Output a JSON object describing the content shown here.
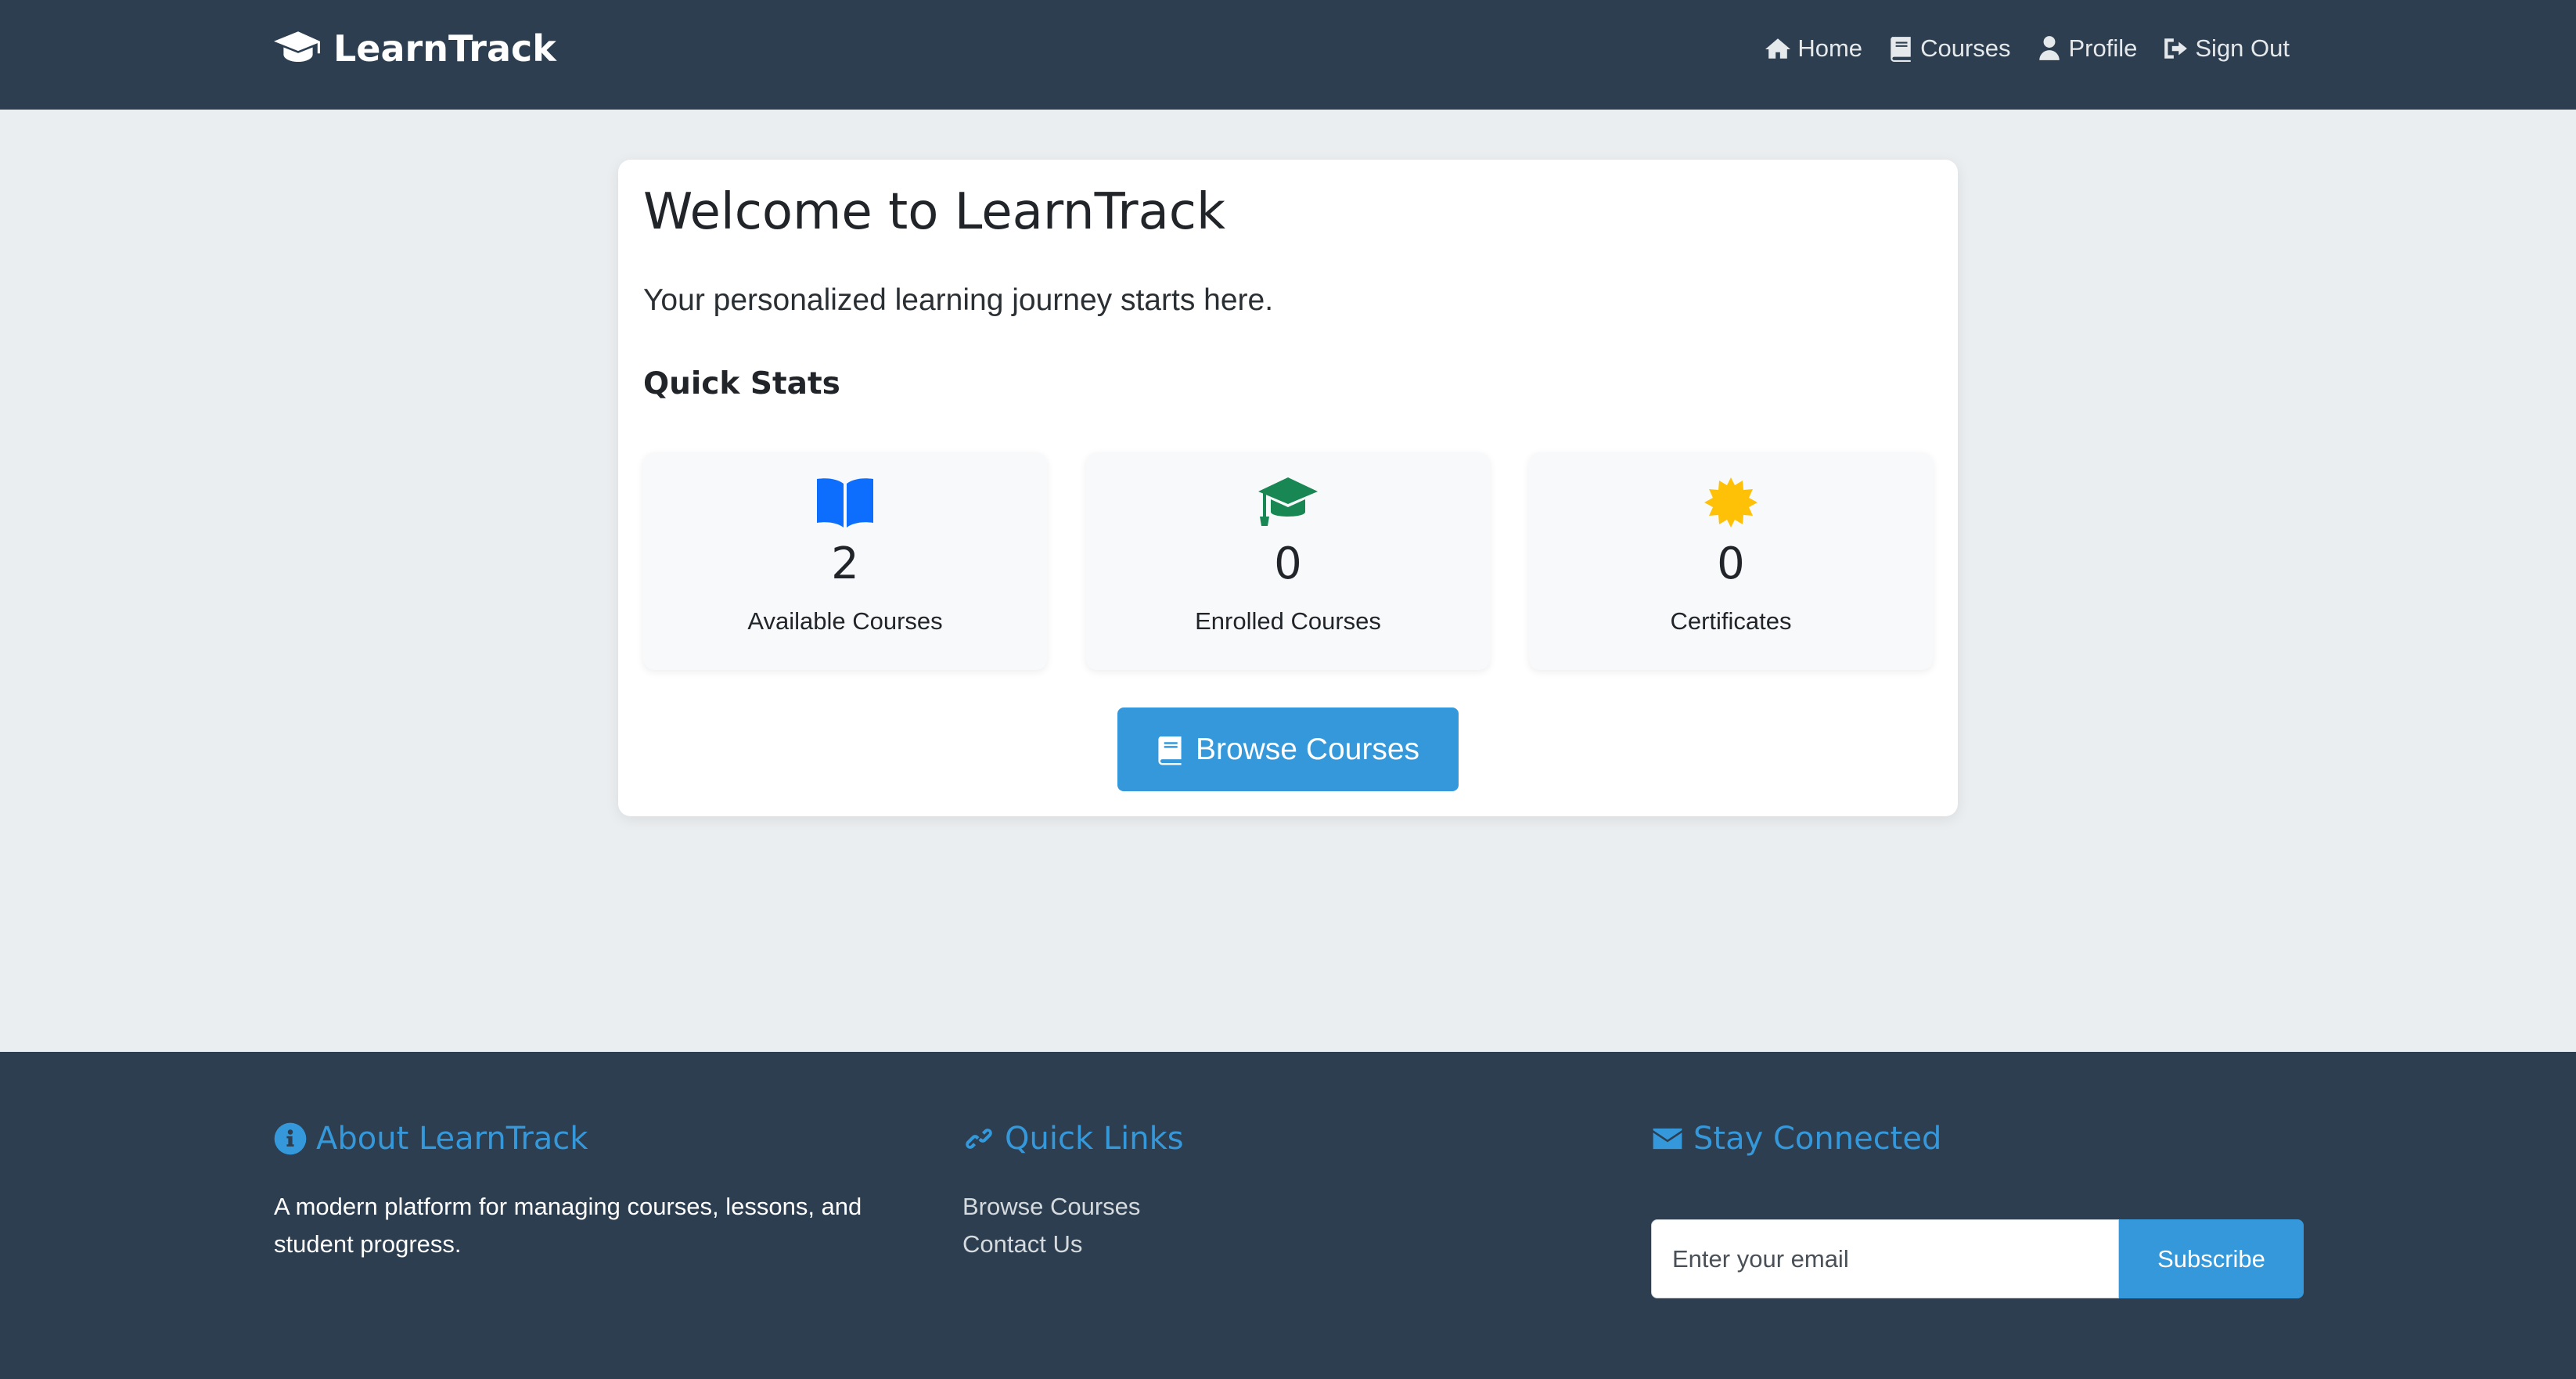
{
  "navbar": {
    "brand": "LearnTrack",
    "links": [
      {
        "label": "Home",
        "icon": "home-icon"
      },
      {
        "label": "Courses",
        "icon": "book-icon"
      },
      {
        "label": "Profile",
        "icon": "user-icon"
      },
      {
        "label": "Sign Out",
        "icon": "sign-out-icon"
      }
    ]
  },
  "main": {
    "title": "Welcome to LearnTrack",
    "lead": "Your personalized learning journey starts here.",
    "stats_heading": "Quick Stats",
    "stats": [
      {
        "value": "2",
        "label": "Available Courses",
        "icon": "open-book-icon",
        "color": "#0d6efd"
      },
      {
        "value": "0",
        "label": "Enrolled Courses",
        "icon": "graduation-cap-icon",
        "color": "#198754"
      },
      {
        "value": "0",
        "label": "Certificates",
        "icon": "certificate-icon",
        "color": "#ffc107"
      }
    ],
    "browse_button": "Browse Courses"
  },
  "footer": {
    "about": {
      "heading": "About LearnTrack",
      "text": "A modern platform for managing courses, lessons, and student progress."
    },
    "quick_links": {
      "heading": "Quick Links",
      "links": [
        "Browse Courses",
        "Contact Us"
      ]
    },
    "stay_connected": {
      "heading": "Stay Connected",
      "email_placeholder": "Enter your email",
      "subscribe_label": "Subscribe"
    }
  },
  "colors": {
    "navbar_bg": "#2c3e50",
    "accent": "#3498db",
    "page_bg": "#ebeef0"
  }
}
